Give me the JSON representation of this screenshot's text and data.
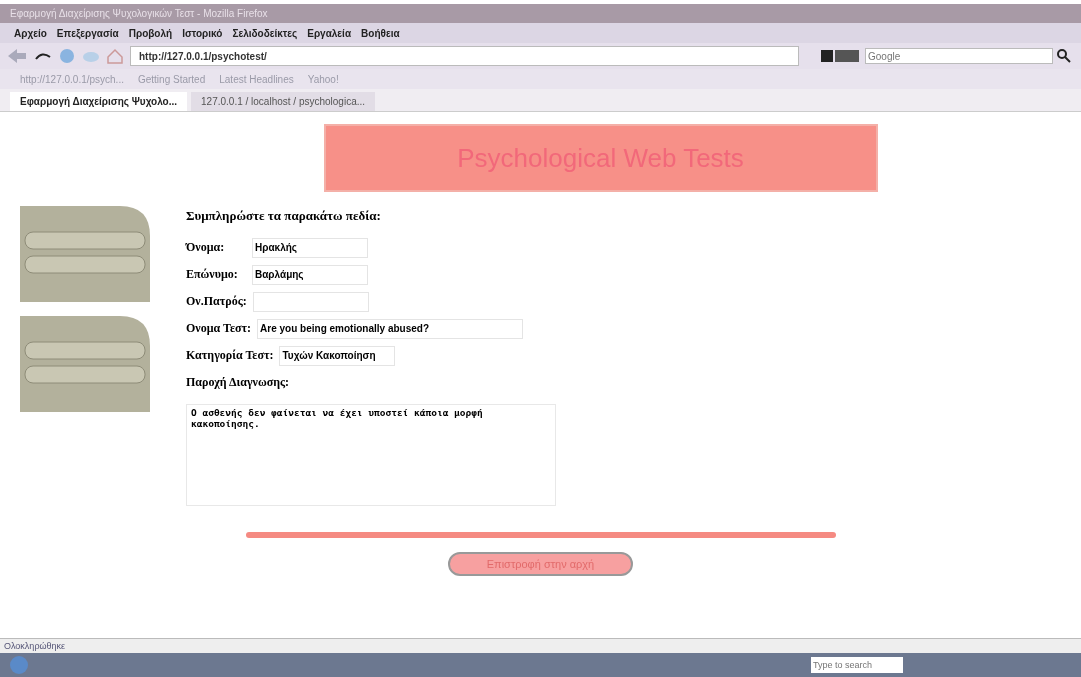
{
  "window": {
    "title": "Εφαρμογή Διαχείρισης Ψυχολογικών Τεστ - Mozilla Firefox"
  },
  "menu": [
    "Αρχείο",
    "Επεξεργασία",
    "Προβολή",
    "Ιστορικό",
    "Σελιδοδείκτες",
    "Εργαλεία",
    "Βοήθεια"
  ],
  "address": {
    "value": "http://127.0.0.1/psychotest/"
  },
  "search": {
    "placeholder": "Google"
  },
  "bookmarks": [
    "http://127.0.0.1/psych...",
    "Getting Started",
    "Latest Headlines",
    "Yahoo!"
  ],
  "tabs": [
    {
      "label": "Εφαρμογή Διαχείρισης Ψυχολο...",
      "selected": true
    },
    {
      "label": "127.0.0.1 / localhost / psychologica...",
      "selected": false
    }
  ],
  "page": {
    "banner": "Psychological Web Tests",
    "heading": "Συμπληρώστε τα παρακάτω πεδία:",
    "fields": [
      {
        "label": "Όνομα:",
        "value": "Ηρακλής",
        "kind": "short"
      },
      {
        "label": "Επώνυμο:",
        "value": "Βαρλάμης",
        "kind": "short"
      },
      {
        "label": "Ον.Πατρός:",
        "kind": "short"
      },
      {
        "label": "Ονομα Τεστ:",
        "value": "Are you being emotionally abused?",
        "kind": "long"
      },
      {
        "label": "Κατηγορία Τεστ:",
        "value": "Τυχών Κακοποίηση",
        "kind": "short"
      }
    ],
    "diagnosis_label": "Παροχή Διαγνωσης:",
    "diagnosis": "Ο ασθενής δεν φαίνεται να έχει υποστεί κάποια μορφή κακοποίησης.",
    "button": "Επιστροφή στην αρχή"
  },
  "status_bar": "Ολοκληρώθηκε",
  "taskbar": {
    "search_placeholder": "Type to search"
  }
}
